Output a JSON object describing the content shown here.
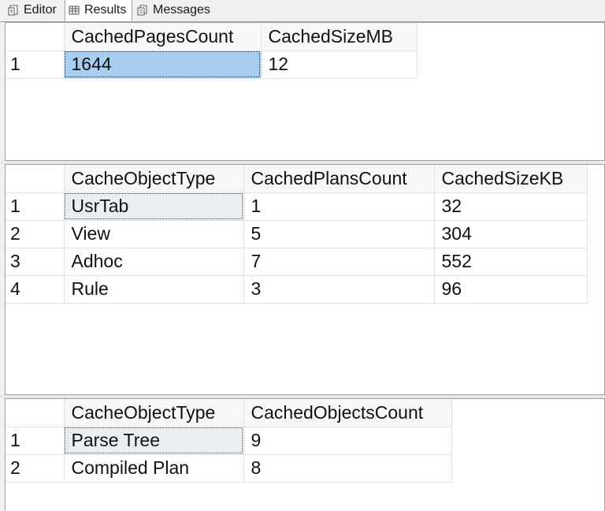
{
  "tabs": {
    "editor": "Editor",
    "results": "Results",
    "messages": "Messages"
  },
  "result1": {
    "columns": [
      "CachedPagesCount",
      "CachedSizeMB"
    ],
    "rows": [
      {
        "num": "1",
        "cells": [
          "1644",
          "12"
        ]
      }
    ]
  },
  "result2": {
    "columns": [
      "CacheObjectType",
      "CachedPlansCount",
      "CachedSizeKB"
    ],
    "rows": [
      {
        "num": "1",
        "cells": [
          "UsrTab",
          "1",
          "32"
        ]
      },
      {
        "num": "2",
        "cells": [
          "View",
          "5",
          "304"
        ]
      },
      {
        "num": "3",
        "cells": [
          "Adhoc",
          "7",
          "552"
        ]
      },
      {
        "num": "4",
        "cells": [
          "Rule",
          "3",
          "96"
        ]
      }
    ]
  },
  "result3": {
    "columns": [
      "CacheObjectType",
      "CachedObjectsCount"
    ],
    "rows": [
      {
        "num": "1",
        "cells": [
          "Parse Tree",
          "9"
        ]
      },
      {
        "num": "2",
        "cells": [
          "Compiled Plan",
          "8"
        ]
      }
    ]
  },
  "colors": {
    "selected_cell": "#a7cdf0",
    "current_cell": "#e9eef3",
    "grid_line": "#e2e2e2"
  }
}
